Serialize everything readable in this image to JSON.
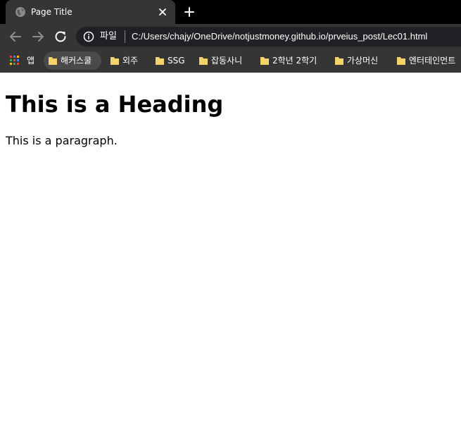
{
  "browser": {
    "tab": {
      "title": "Page Title",
      "favicon": "globe-icon",
      "close_icon": "close-icon"
    },
    "new_tab_icon": "plus-icon",
    "toolbar": {
      "back_icon": "back-arrow-icon",
      "forward_icon": "forward-arrow-icon",
      "reload_icon": "reload-icon",
      "omnibox": {
        "info_icon": "info-icon",
        "scheme_label": "파일",
        "url": "C:/Users/chajy/OneDrive/notjustmoney.github.io/prveius_post/Lec01.html"
      }
    },
    "bookmarks": {
      "apps_label": "앱",
      "items": [
        {
          "label": "해커스쿨"
        },
        {
          "label": "외주"
        },
        {
          "label": "SSG"
        },
        {
          "label": "잡동사니"
        },
        {
          "label": "2학년 2학기"
        },
        {
          "label": "가상머신"
        },
        {
          "label": "엔터테인먼트"
        }
      ]
    }
  },
  "page": {
    "heading": "This is a Heading",
    "paragraph": "This is a paragraph."
  },
  "colors": {
    "tabstrip": "#000000",
    "toolbar": "#353535",
    "omnibox": "#202124",
    "folder": "#f5d36b",
    "page_bg": "#ffffff"
  }
}
